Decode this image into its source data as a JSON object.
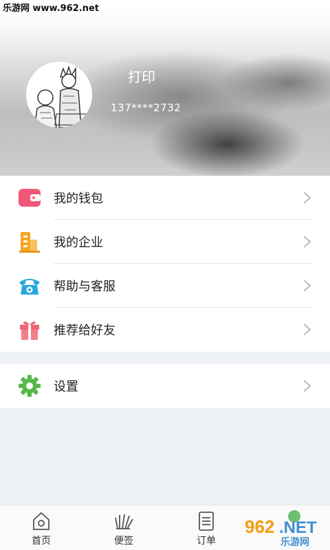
{
  "watermark": {
    "text": "乐游网 www.962.net"
  },
  "profile": {
    "name": "打印",
    "phone": "137****2732"
  },
  "menu_group_1": [
    {
      "label": "我的钱包",
      "icon": "wallet-icon",
      "color": "#f0587a"
    },
    {
      "label": "我的企业",
      "icon": "building-icon",
      "color": "#f5a623"
    },
    {
      "label": "帮助与客服",
      "icon": "telephone-icon",
      "color": "#29a8e0"
    },
    {
      "label": "推荐给好友",
      "icon": "gift-icon",
      "color": "#f06473"
    }
  ],
  "menu_group_2": [
    {
      "label": "设置",
      "icon": "gear-icon",
      "color": "#57b84a"
    }
  ],
  "tabbar": [
    {
      "label": "首页",
      "icon": "home-icon"
    },
    {
      "label": "便签",
      "icon": "memo-icon"
    },
    {
      "label": "订单",
      "icon": "order-icon"
    }
  ],
  "logo": {
    "text": "962.NET",
    "subtext": "乐游网"
  }
}
